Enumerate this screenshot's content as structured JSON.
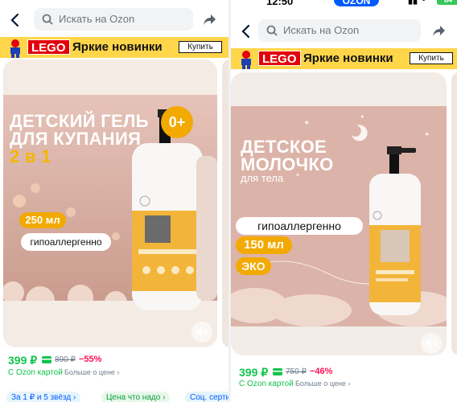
{
  "status": {
    "time": "12:50",
    "brand": "OZON",
    "battery": "84"
  },
  "search": {
    "placeholder": "Искать на Ozon"
  },
  "banner": {
    "brand": "LEGO",
    "slogan": "Яркие новинки",
    "buy_label": "Купить"
  },
  "left": {
    "headline": [
      "ДЕТСКИЙ ГЕЛЬ",
      "ДЛЯ КУПАНИЯ",
      "2 в 1"
    ],
    "age_badge": "0+",
    "volume": "250 мл",
    "hypo": "гипоаллергенно",
    "price": "399 ₽",
    "old_price": "890 ₽",
    "discount": "−55%",
    "ozon_card": "С Ozon картой",
    "more_price": "Больше о цене ›",
    "tags": [
      "За 1 ₽ и 5 звёзд ›",
      "Цена что надо ›",
      "Соц. серти"
    ]
  },
  "right": {
    "headline": [
      "ДЕТСКОЕ",
      "МОЛОЧКО"
    ],
    "sub": "для тела",
    "hypo": "гипоаллергенно",
    "volume": "150 мл",
    "eco": "ЭКО",
    "price": "399 ₽",
    "old_price": "750 ₽",
    "discount": "−46%",
    "ozon_card": "С Ozon картой",
    "more_price": "Больше о цене ›"
  },
  "colors": {
    "price_green": "#10c44c",
    "discount": "#f91155",
    "accent": "#f2a900",
    "ozon_blue": "#005bff",
    "banner": "#ffd64a"
  }
}
